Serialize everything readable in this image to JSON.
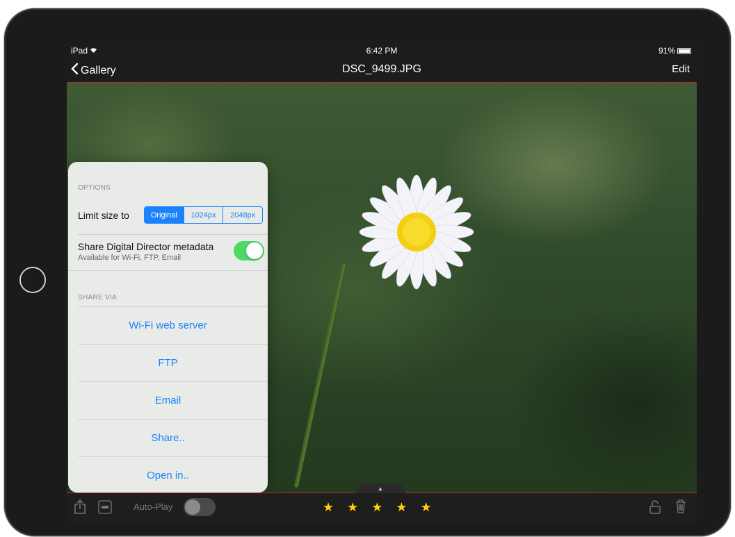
{
  "statusbar": {
    "device": "iPad",
    "wifi_icon": "wifi-icon",
    "time": "6:42 PM",
    "battery": "91%",
    "battery_level": 0.91
  },
  "navbar": {
    "back_label": "Gallery",
    "title": "DSC_9499.JPG",
    "edit_label": "Edit"
  },
  "options": {
    "section_label": "OPTIONS",
    "limit_label": "Limit size to",
    "sizes": [
      "Original",
      "1024px",
      "2048px"
    ],
    "selected_size": "Original",
    "metadata_title": "Share Digital Director metadata",
    "metadata_sub": "Available for Wi-Fi, FTP, Email",
    "metadata_enabled": true
  },
  "share": {
    "section_label": "SHARE VIA",
    "items": [
      "Wi-Fi web server",
      "FTP",
      "Email",
      "Share..",
      "Open in.."
    ]
  },
  "toolbar": {
    "autoplay_label": "Auto-Play",
    "autoplay_enabled": false,
    "rating": 5,
    "rating_max": 5,
    "icons": [
      "share-icon",
      "wifi-badge-icon",
      "unlock-icon",
      "trash-icon"
    ]
  },
  "colors": {
    "accent": "#1a82fb",
    "toggle_on": "#4cd964",
    "divider_red": "#c1272d",
    "star": "#ffd200"
  }
}
